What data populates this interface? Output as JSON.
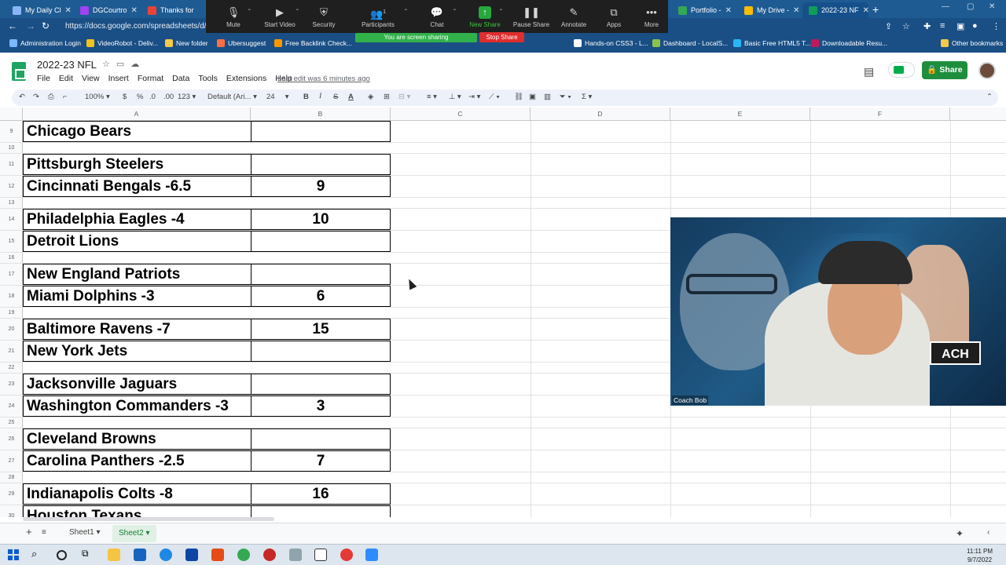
{
  "browser": {
    "tabs": [
      {
        "label": "My Daily Cl",
        "color": "#8ab4f8"
      },
      {
        "label": "DGCourtro",
        "color": "#a142f4"
      },
      {
        "label": "Thanks for",
        "color": "#ea4335"
      },
      {
        "label": "Portfolio - ",
        "color": "#34a853"
      },
      {
        "label": "My Drive - ",
        "color": "#fbbc04"
      },
      {
        "label": "2022-23 NF",
        "color": "#0f9d58"
      }
    ],
    "url": "https://docs.google.com/spreadsheets/d/1",
    "bookmarks": [
      "Administration Login",
      "VideoRobot - Deliv...",
      "New folder",
      "Ubersuggest",
      "Free Backlink Check...",
      "Hands-on CSS3 - L...",
      "Dashboard - LocalS...",
      "Basic Free HTML5 T...",
      "Downloadable Resu...",
      "Other bookmarks"
    ]
  },
  "zoom": {
    "buttons": [
      "Mute",
      "Start Video",
      "Security",
      "Participants",
      "Chat",
      "New Share",
      "Pause Share",
      "Annotate",
      "Apps",
      "More"
    ],
    "participants_count": "1",
    "sharing_text": "You are screen sharing",
    "stop_share": "Stop Share"
  },
  "sheets": {
    "title": "2022-23 NFL",
    "menu": [
      "File",
      "Edit",
      "View",
      "Insert",
      "Format",
      "Data",
      "Tools",
      "Extensions",
      "Help"
    ],
    "last_edit": "Last edit was 6 minutes ago",
    "share_label": "Share",
    "toolbar": {
      "zoom": "100%",
      "currency": "$",
      "percent": "%",
      "dec_less": ".0",
      "dec_more": ".00",
      "format": "123",
      "font": "Default (Ari...",
      "font_size": "24",
      "bold": "B",
      "italic": "I",
      "strike": "S",
      "text_color": "A",
      "sum": "Σ"
    },
    "columns": [
      "A",
      "B",
      "C",
      "D",
      "E",
      "F"
    ],
    "rows": [
      {
        "num": "9",
        "a": "Chicago Bears",
        "b": "",
        "bordered": true
      },
      {
        "num": "10",
        "a": "",
        "b": "",
        "bordered": false
      },
      {
        "num": "11",
        "a": "Pittsburgh Steelers",
        "b": "",
        "bordered": true
      },
      {
        "num": "12",
        "a": "Cincinnati Bengals -6.5",
        "b": "9",
        "bordered": true
      },
      {
        "num": "13",
        "a": "",
        "b": "",
        "bordered": false
      },
      {
        "num": "14",
        "a": "Philadelphia Eagles -4",
        "b": "10",
        "bordered": true
      },
      {
        "num": "15",
        "a": "Detroit Lions",
        "b": "",
        "bordered": true
      },
      {
        "num": "16",
        "a": "",
        "b": "",
        "bordered": false
      },
      {
        "num": "17",
        "a": "New England Patriots",
        "b": "",
        "bordered": true
      },
      {
        "num": "18",
        "a": "Miami Dolphins -3",
        "b": "6",
        "bordered": true
      },
      {
        "num": "19",
        "a": "",
        "b": "",
        "bordered": false
      },
      {
        "num": "20",
        "a": "Baltimore Ravens -7",
        "b": "15",
        "bordered": true
      },
      {
        "num": "21",
        "a": "New York Jets",
        "b": "",
        "bordered": true
      },
      {
        "num": "22",
        "a": "",
        "b": "",
        "bordered": false
      },
      {
        "num": "23",
        "a": "Jacksonville Jaguars",
        "b": "",
        "bordered": true
      },
      {
        "num": "24",
        "a": "Washington Commanders -3",
        "b": "3",
        "bordered": true
      },
      {
        "num": "25",
        "a": "",
        "b": "",
        "bordered": false
      },
      {
        "num": "26",
        "a": "Cleveland Browns",
        "b": "",
        "bordered": true
      },
      {
        "num": "27",
        "a": "Carolina Panthers -2.5",
        "b": "7",
        "bordered": true
      },
      {
        "num": "28",
        "a": "",
        "b": "",
        "bordered": false
      },
      {
        "num": "29",
        "a": "Indianapolis Colts -8",
        "b": "16",
        "bordered": true
      },
      {
        "num": "30",
        "a": "Houston Texans",
        "b": "",
        "bordered": true
      }
    ],
    "sheet_tabs": [
      "Sheet1",
      "Sheet2"
    ],
    "active_sheet": "Sheet2"
  },
  "webcam": {
    "name": "Coach Bob",
    "badge": "ACH"
  },
  "taskbar": {
    "time": "11:11 PM",
    "date": "9/7/2022"
  }
}
